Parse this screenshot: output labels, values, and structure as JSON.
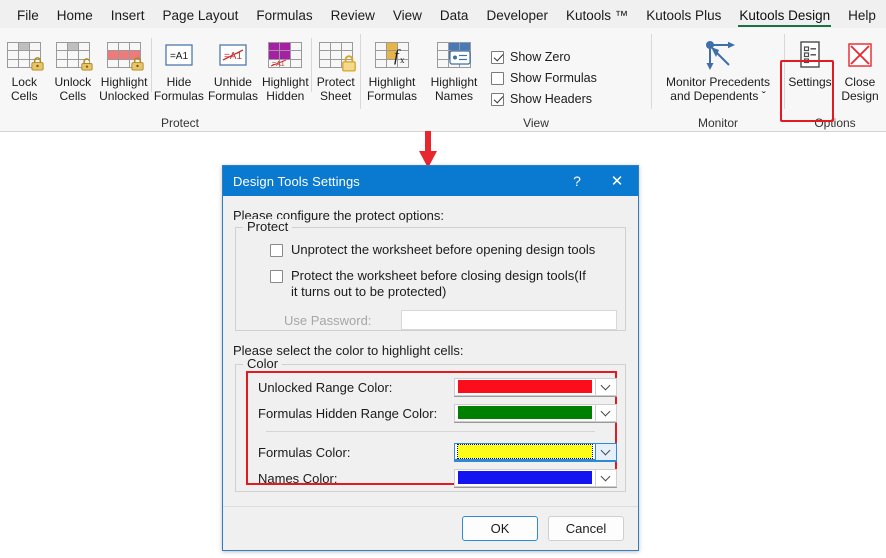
{
  "ribbon": {
    "tabs": [
      {
        "label": "File",
        "active": false
      },
      {
        "label": "Home",
        "active": false
      },
      {
        "label": "Insert",
        "active": false
      },
      {
        "label": "Page Layout",
        "active": false
      },
      {
        "label": "Formulas",
        "active": false
      },
      {
        "label": "Review",
        "active": false
      },
      {
        "label": "View",
        "active": false
      },
      {
        "label": "Data",
        "active": false
      },
      {
        "label": "Developer",
        "active": false
      },
      {
        "label": "Kutools ™",
        "active": false
      },
      {
        "label": "Kutools Plus",
        "active": false
      },
      {
        "label": "Kutools Design",
        "active": true
      },
      {
        "label": "Help",
        "active": false
      }
    ],
    "groups": [
      {
        "name": "Protect",
        "label": "Protect",
        "buttons": [
          {
            "caption": "Lock\nCells",
            "icon": "lock-cells-icon"
          },
          {
            "caption": "Unlock\nCells",
            "icon": "unlock-cells-icon"
          },
          {
            "caption": "Highlight\nUnlocked",
            "icon": "highlight-unlocked-icon"
          },
          {
            "caption": "Hide\nFormulas",
            "icon": "hide-formulas-icon"
          },
          {
            "caption": "Unhide\nFormulas",
            "icon": "unhide-formulas-icon"
          },
          {
            "caption": "Highlight\nHidden",
            "icon": "highlight-hidden-icon"
          },
          {
            "caption": "Protect\nSheet",
            "icon": "protect-sheet-icon"
          }
        ]
      },
      {
        "name": "View",
        "label": "View",
        "buttons": [
          {
            "caption": "Highlight\nFormulas",
            "icon": "highlight-formulas-icon"
          },
          {
            "caption": "Highlight\nNames",
            "icon": "highlight-names-icon"
          }
        ],
        "checkboxes": [
          {
            "label": "Show Zero",
            "checked": true
          },
          {
            "label": "Show Formulas",
            "checked": false
          },
          {
            "label": "Show Headers",
            "checked": true
          }
        ]
      },
      {
        "name": "Monitor",
        "label": "Monitor",
        "buttons": [
          {
            "caption": "Monitor Precedents\nand Dependents ˇ",
            "icon": "precedents-dependents-icon"
          }
        ]
      },
      {
        "name": "Options",
        "label": "Options",
        "buttons": [
          {
            "caption": "Settings",
            "icon": "settings-icon",
            "highlighted": true
          },
          {
            "caption": "Close\nDesign",
            "icon": "close-design-icon"
          }
        ]
      }
    ]
  },
  "annotation": {
    "arrow_color": "#e8262d",
    "highlight_color": "#e01b22"
  },
  "dialog": {
    "title": "Design Tools Settings",
    "help_label": "?",
    "close_label": "✕",
    "lead_protect": "Please configure the protect options:",
    "protect_group_legend": "Protect",
    "protect_options": [
      {
        "label": "Unprotect the worksheet before opening design tools",
        "checked": false
      },
      {
        "label": "Protect the worksheet before closing design tools(If it turns out to be protected)",
        "checked": false
      }
    ],
    "password_label": "Use Password:",
    "password_value": "",
    "password_placeholder": "",
    "lead_color": "Please select the color to highlight cells:",
    "color_group_legend": "Color",
    "color_rows": [
      {
        "label": "Unlocked Range Color:",
        "color": "#fc0d1b",
        "focused": false
      },
      {
        "label": "Formulas Hidden Range Color:",
        "color": "#008000",
        "focused": false
      },
      {
        "label": "Formulas Color:",
        "color": "#fdfc18",
        "focused": true
      },
      {
        "label": "Names Color:",
        "color": "#1414f0",
        "focused": false
      }
    ],
    "ok_label": "OK",
    "cancel_label": "Cancel"
  }
}
